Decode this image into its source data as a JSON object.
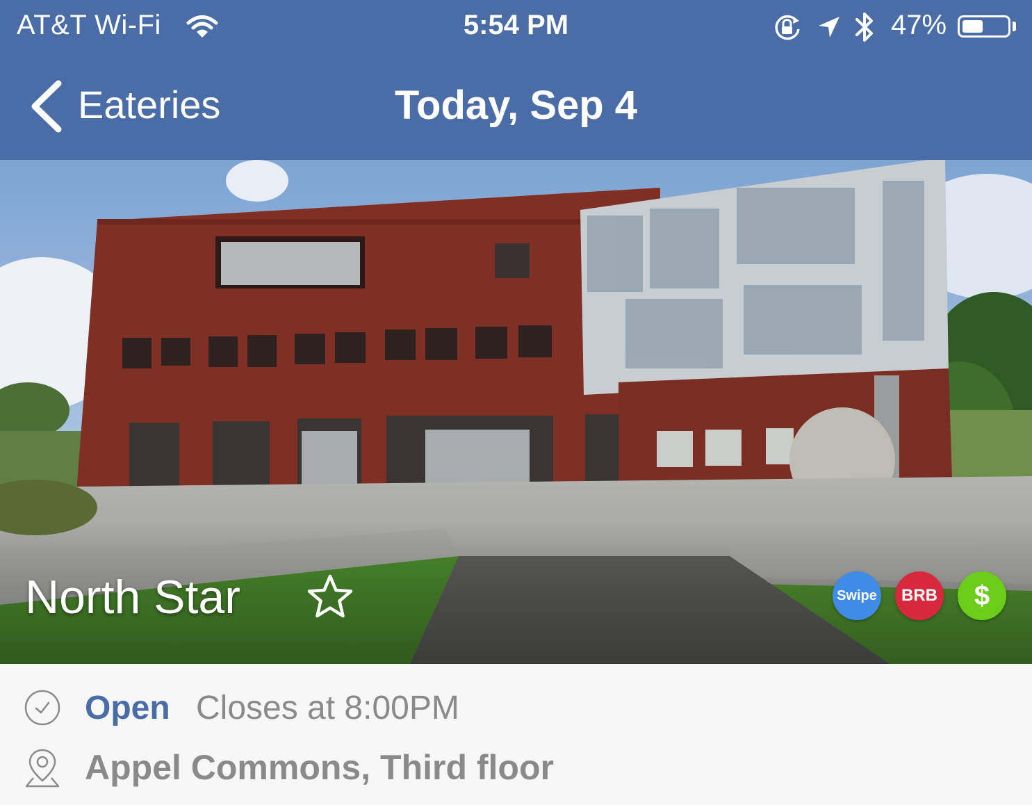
{
  "status_bar": {
    "carrier": "AT&T Wi-Fi",
    "time": "5:54 PM",
    "battery_percent": "47%",
    "battery_level": 0.47,
    "icons": [
      "wifi-icon",
      "rotation-lock-icon",
      "location-arrow-icon",
      "bluetooth-icon",
      "battery-icon"
    ]
  },
  "nav": {
    "back_label": "Eateries",
    "title": "Today, Sep 4",
    "back_icon": "chevron-left-icon"
  },
  "eatery": {
    "name": "North Star",
    "favorite_icon": "star-outline-icon",
    "payment_methods": [
      {
        "label": "Swipe",
        "color": "#3f8be6"
      },
      {
        "label": "BRB",
        "color": "#d8283d"
      },
      {
        "label": "$",
        "color": "#6ccc1a"
      }
    ],
    "status": "Open",
    "status_color": "#4a6da7",
    "hours_text": "Closes at 8:00PM",
    "location": "Appel Commons, Third floor",
    "hours_icon": "clock-icon",
    "location_icon": "map-pin-icon"
  },
  "colors": {
    "brand": "#4a6da7",
    "secondary_text": "#8a8a8a"
  }
}
